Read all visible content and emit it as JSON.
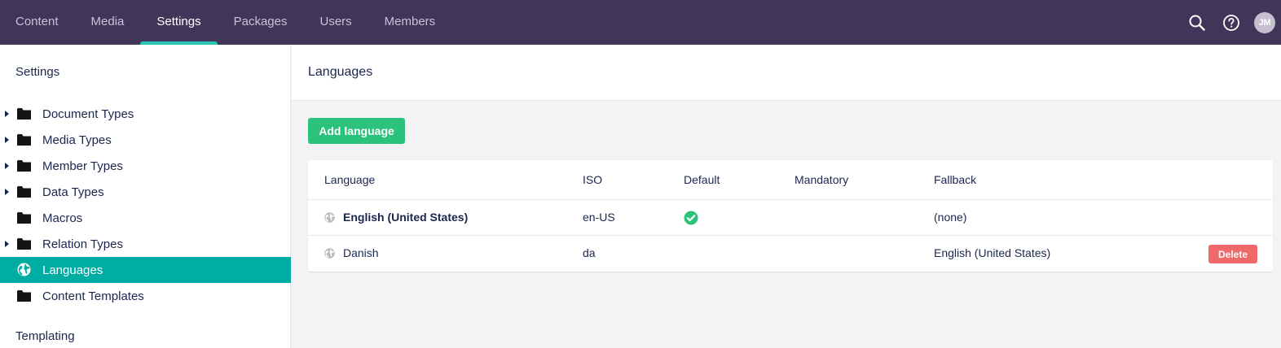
{
  "topnav": {
    "items": [
      {
        "label": "Content"
      },
      {
        "label": "Media"
      },
      {
        "label": "Settings"
      },
      {
        "label": "Packages"
      },
      {
        "label": "Users"
      },
      {
        "label": "Members"
      }
    ],
    "active": "Settings",
    "icons": [
      "search-icon",
      "help-icon"
    ],
    "avatar_initials": "JM"
  },
  "sidebar": {
    "title": "Settings",
    "items": [
      {
        "label": "Document Types",
        "icon": "folder-icon",
        "expandable": true
      },
      {
        "label": "Media Types",
        "icon": "folder-icon",
        "expandable": true
      },
      {
        "label": "Member Types",
        "icon": "folder-icon",
        "expandable": true
      },
      {
        "label": "Data Types",
        "icon": "folder-icon",
        "expandable": true
      },
      {
        "label": "Macros",
        "icon": "folder-icon",
        "expandable": false
      },
      {
        "label": "Relation Types",
        "icon": "folder-icon",
        "expandable": true
      },
      {
        "label": "Languages",
        "icon": "globe-icon",
        "expandable": false,
        "active": true
      },
      {
        "label": "Content Templates",
        "icon": "folder-icon",
        "expandable": false
      }
    ],
    "section2_title": "Templating"
  },
  "main": {
    "title": "Languages",
    "add_button": "Add language",
    "table": {
      "headers": [
        "Language",
        "ISO",
        "Default",
        "Mandatory",
        "Fallback"
      ],
      "rows": [
        {
          "language": "English (United States)",
          "iso": "en-US",
          "default": true,
          "mandatory": "",
          "fallback": "(none)"
        },
        {
          "language": "Danish",
          "iso": "da",
          "default": false,
          "mandatory": "",
          "fallback": "English (United States)",
          "action": "Delete"
        }
      ]
    }
  },
  "colors": {
    "topbar": "#413659",
    "accent": "#2bc6b3",
    "active_item": "#00ada3",
    "add_button": "#2bc37c",
    "delete_button": "#f0686a"
  }
}
